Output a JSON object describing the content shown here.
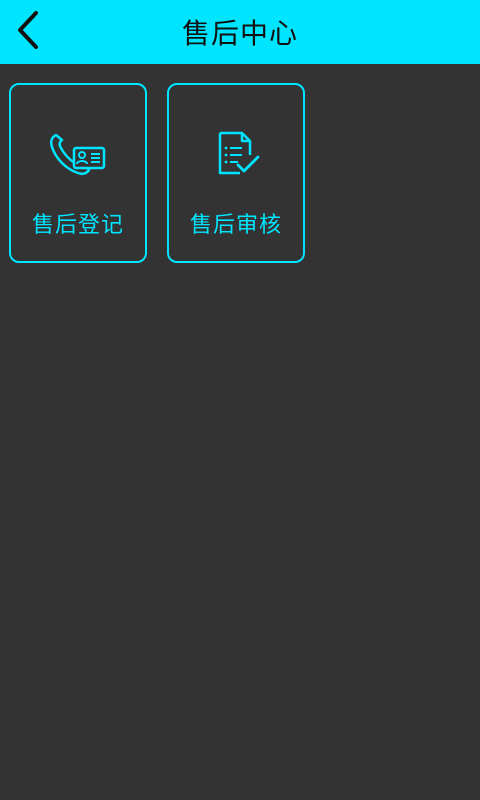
{
  "header": {
    "title": "售后中心",
    "back_icon": "chevron-left-icon"
  },
  "tiles": [
    {
      "label": "售后登记",
      "icon": "phone-contact-card-icon"
    },
    {
      "label": "售后审核",
      "icon": "document-check-icon"
    }
  ],
  "colors": {
    "accent": "#00e5ff",
    "background": "#333333",
    "header_text": "#111111"
  }
}
